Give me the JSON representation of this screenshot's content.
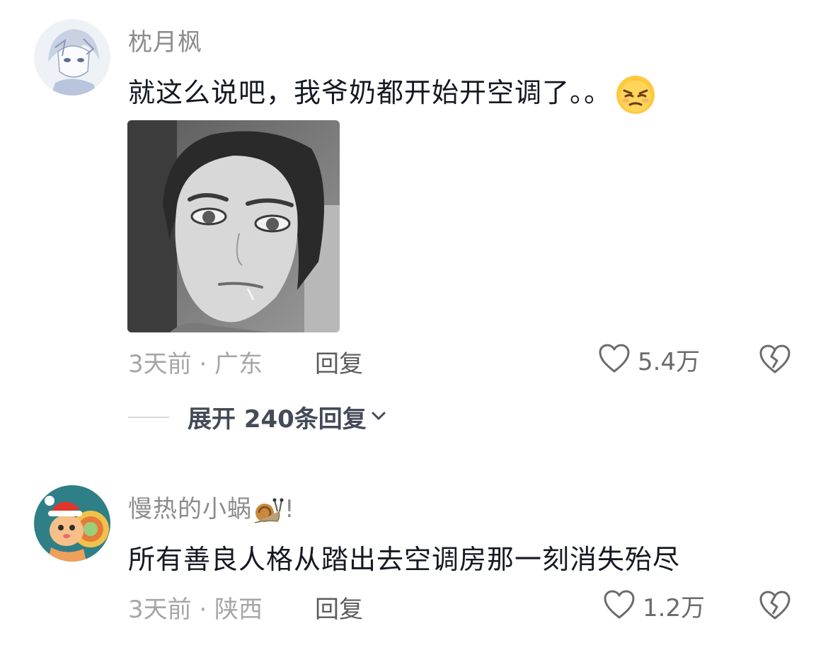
{
  "comments": [
    {
      "username": "枕月枫",
      "text": "就这么说吧，我爷奶都开始开空调了。。",
      "emoji": "unamused-face-emoji",
      "image": "anime-character-portrait-image",
      "time_location": "3天前 · 广东",
      "reply_label": "回复",
      "likes": "5.4万",
      "expand_label": "展开 240条回复"
    },
    {
      "username": "慢热的小蜗",
      "username_suffix": "!",
      "text": "所有善良人格从踏出去空调房那一刻消失殆尽",
      "time_location": "3天前 · 陕西",
      "reply_label": "回复",
      "likes": "1.2万"
    }
  ],
  "icons": {
    "like": "heart-outline-icon",
    "dislike": "broken-heart-icon",
    "expand": "chevron-down-icon"
  },
  "colors": {
    "username": "#8c8c8c",
    "text": "#161823",
    "meta": "#a6a6a6",
    "emoji_yellow": "#ffc83d"
  }
}
